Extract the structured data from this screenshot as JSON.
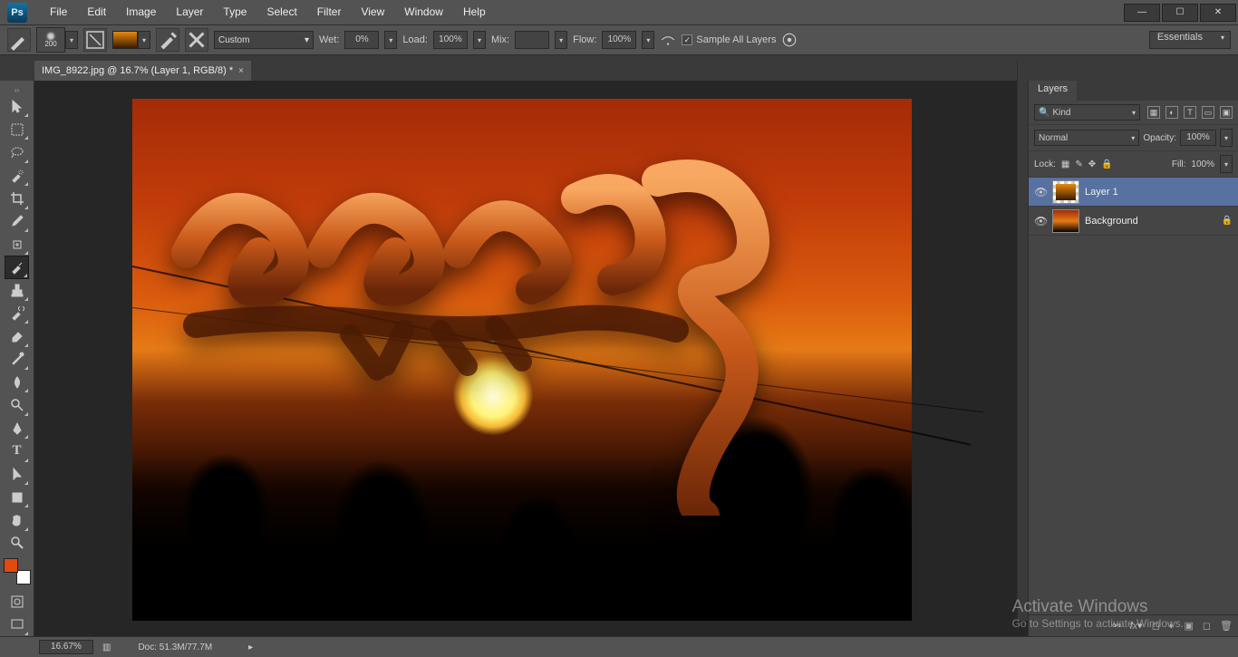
{
  "menu": {
    "items": [
      "File",
      "Edit",
      "Image",
      "Layer",
      "Type",
      "Select",
      "Filter",
      "View",
      "Window",
      "Help"
    ]
  },
  "options": {
    "brush_size": "200",
    "mode_label": "Custom",
    "wet_label": "Wet:",
    "wet_value": "0%",
    "load_label": "Load:",
    "load_value": "100%",
    "mix_label": "Mix:",
    "mix_value": "",
    "flow_label": "Flow:",
    "flow_value": "100%",
    "sample_all_label": "Sample All Layers"
  },
  "workspace": {
    "label": "Essentials"
  },
  "document": {
    "tab_title": "IMG_8922.jpg @ 16.7% (Layer 1, RGB/8) *"
  },
  "layers_panel": {
    "tab": "Layers",
    "filter_label": "Kind",
    "blend_mode": "Normal",
    "opacity_label": "Opacity:",
    "opacity_value": "100%",
    "lock_label": "Lock:",
    "fill_label": "Fill:",
    "fill_value": "100%",
    "layers": [
      {
        "name": "Layer 1",
        "locked": false
      },
      {
        "name": "Background",
        "locked": true
      }
    ]
  },
  "status": {
    "zoom": "16.67%",
    "doc_label": "Doc:",
    "doc_value": "51.3M/77.7M"
  },
  "activate": {
    "title": "Activate Windows",
    "subtitle": "Go to Settings to activate Windows."
  }
}
